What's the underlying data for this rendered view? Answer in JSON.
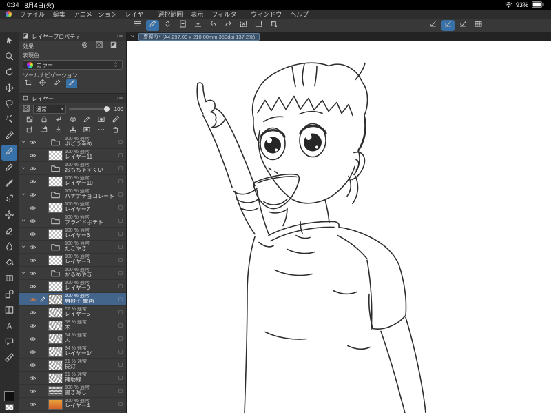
{
  "status_bar": {
    "time": "0:34",
    "date": "8月4日(火)",
    "battery_percent": "93%"
  },
  "menu_bar": {
    "items": [
      "ファイル",
      "編集",
      "アニメーション",
      "レイヤー",
      "選択範囲",
      "表示",
      "フィルター",
      "ウィンドウ",
      "ヘルプ"
    ]
  },
  "toolbar": {
    "left_icons": [
      {
        "name": "main-menu-button",
        "icon": "menu"
      },
      {
        "name": "current-tool-button",
        "icon": "pen",
        "selected": true
      },
      {
        "name": "tool-switch-button",
        "icon": "chevrons"
      },
      {
        "name": "new-canvas-button",
        "icon": "doc-new"
      },
      {
        "name": "export-button",
        "icon": "export"
      },
      {
        "name": "undo-button",
        "icon": "undo"
      },
      {
        "name": "redo-button",
        "icon": "redo"
      },
      {
        "name": "clear-button",
        "icon": "clear"
      },
      {
        "name": "deselect-button",
        "icon": "deselect"
      },
      {
        "name": "transform-button",
        "icon": "transform"
      }
    ],
    "right_icons": [
      {
        "name": "stabilization-a-button",
        "icon": "check-pen"
      },
      {
        "name": "stabilization-b-button",
        "icon": "check-pen",
        "selected": true
      },
      {
        "name": "stabilization-c-button",
        "icon": "check-pen"
      },
      {
        "name": "shortcut-bar-button",
        "icon": "grid"
      }
    ]
  },
  "tool_palette": {
    "items": [
      {
        "name": "operation",
        "icon": "cursor"
      },
      {
        "name": "zoom",
        "icon": "magnifier"
      },
      {
        "name": "rotate-canvas",
        "icon": "rotate"
      },
      {
        "name": "move-layer",
        "icon": "move"
      },
      {
        "name": "selection",
        "icon": "lasso"
      },
      {
        "name": "auto-select",
        "icon": "wand"
      },
      {
        "name": "eyedropper",
        "icon": "dropper"
      },
      {
        "name": "pen",
        "icon": "pen",
        "selected": true
      },
      {
        "name": "pencil",
        "icon": "pencil"
      },
      {
        "name": "brush",
        "icon": "brush"
      },
      {
        "name": "airbrush",
        "icon": "airbrush"
      },
      {
        "name": "decoration",
        "icon": "decoration"
      },
      {
        "name": "eraser",
        "icon": "eraser"
      },
      {
        "name": "blend",
        "icon": "blend"
      },
      {
        "name": "fill",
        "icon": "bucket"
      },
      {
        "name": "gradient",
        "icon": "gradient"
      },
      {
        "name": "figure",
        "icon": "figure"
      },
      {
        "name": "frame",
        "icon": "frame"
      },
      {
        "name": "text",
        "icon": "text"
      },
      {
        "name": "balloon",
        "icon": "balloon"
      },
      {
        "name": "correction",
        "icon": "ruler"
      }
    ]
  },
  "layer_property": {
    "title": "レイヤープロパティ",
    "effect_label": "効果",
    "effect_icons": [
      {
        "name": "border-effect",
        "icon": "ring"
      },
      {
        "name": "tone-effect",
        "icon": "tone"
      },
      {
        "name": "layer-color-effect",
        "icon": "half"
      }
    ],
    "expression_label": "表現色",
    "color_value": "カラー",
    "toolnav_label": "ツールナビゲーション",
    "toolnav_icons": [
      {
        "name": "nav-transform",
        "icon": "transform"
      },
      {
        "name": "nav-move",
        "icon": "move"
      },
      {
        "name": "nav-pen",
        "icon": "pen"
      },
      {
        "name": "nav-brush",
        "icon": "brush",
        "selected": true
      }
    ]
  },
  "layer_panel": {
    "title": "レイヤー",
    "blend_mode": "通常",
    "opacity_value": "100",
    "header_icons_row1": [
      {
        "name": "lock-transparent-pixels",
        "icon": "checker"
      },
      {
        "name": "lock-layer",
        "icon": "lock"
      },
      {
        "name": "clip-to-layer-below",
        "icon": "clip"
      },
      {
        "name": "reference-layer",
        "icon": "ring"
      },
      {
        "name": "draft-layer",
        "icon": "pencil"
      },
      {
        "name": "enable-mask",
        "icon": "mask"
      },
      {
        "name": "ruler-range",
        "icon": "ruler"
      }
    ],
    "header_icons_row2": [
      {
        "name": "new-raster-layer",
        "icon": "new-layer"
      },
      {
        "name": "new-layer-folder",
        "icon": "folder-plus"
      },
      {
        "name": "transfer-to-below",
        "icon": "export"
      },
      {
        "name": "merge-down",
        "icon": "merge"
      },
      {
        "name": "create-mask",
        "icon": "mask"
      },
      {
        "name": "layer-settings",
        "icon": "dots"
      },
      {
        "name": "delete-layer",
        "icon": "trash"
      }
    ],
    "layers": [
      {
        "type": "folder",
        "opacity": "100 %",
        "mode": "通常",
        "name": "ぶどうあめ"
      },
      {
        "type": "layer",
        "opacity": "100 %",
        "mode": "通常",
        "name": "レイヤー11"
      },
      {
        "type": "folder",
        "opacity": "100 %",
        "mode": "通常",
        "name": "おもちゃすくい"
      },
      {
        "type": "layer",
        "opacity": "100 %",
        "mode": "通常",
        "name": "レイヤー10"
      },
      {
        "type": "folder",
        "opacity": "100 %",
        "mode": "通常",
        "name": "バナナチョコレート"
      },
      {
        "type": "layer",
        "opacity": "100 %",
        "mode": "通常",
        "name": "レイヤー7"
      },
      {
        "type": "folder",
        "opacity": "100 %",
        "mode": "通常",
        "name": "フライドポテト"
      },
      {
        "type": "layer",
        "opacity": "100 %",
        "mode": "通常",
        "name": "レイヤー6"
      },
      {
        "type": "folder",
        "opacity": "100 %",
        "mode": "通常",
        "name": "たこやき"
      },
      {
        "type": "layer",
        "opacity": "100 %",
        "mode": "通常",
        "name": "レイヤー8"
      },
      {
        "type": "folder",
        "opacity": "100 %",
        "mode": "通常",
        "name": "かるめやき"
      },
      {
        "type": "layer",
        "opacity": "100 %",
        "mode": "通常",
        "name": "レイヤー9"
      },
      {
        "type": "layer",
        "opacity": "100 %",
        "mode": "通常",
        "name": "男の子 線画",
        "selected": true,
        "thumb": "sketch"
      },
      {
        "type": "layer",
        "opacity": "67 %",
        "mode": "通常",
        "name": "レイヤー5",
        "thumb": "sketch"
      },
      {
        "type": "layer",
        "opacity": "58 %",
        "mode": "通常",
        "name": "木",
        "thumb": "sketch"
      },
      {
        "type": "layer",
        "opacity": "54 %",
        "mode": "通常",
        "name": "人",
        "thumb": "sketch"
      },
      {
        "type": "layer",
        "opacity": "34 %",
        "mode": "通常",
        "name": "レイヤー14",
        "thumb": "sketch"
      },
      {
        "type": "layer",
        "opacity": "51 %",
        "mode": "通常",
        "name": "提灯",
        "thumb": "sketch"
      },
      {
        "type": "layer",
        "opacity": "61 %",
        "mode": "通常",
        "name": "補助線",
        "thumb": "sketch"
      },
      {
        "type": "layer",
        "opacity": "100 %",
        "mode": "通常",
        "name": "書き写し",
        "thumb": "dark"
      },
      {
        "type": "layer",
        "opacity": "100 %",
        "mode": "通常",
        "name": "レイヤー4",
        "thumb": "orange"
      }
    ]
  },
  "canvas": {
    "tab_label": "夏祭り* (A4 297.00 x 210.00mm 350dpi 137.2%)"
  }
}
